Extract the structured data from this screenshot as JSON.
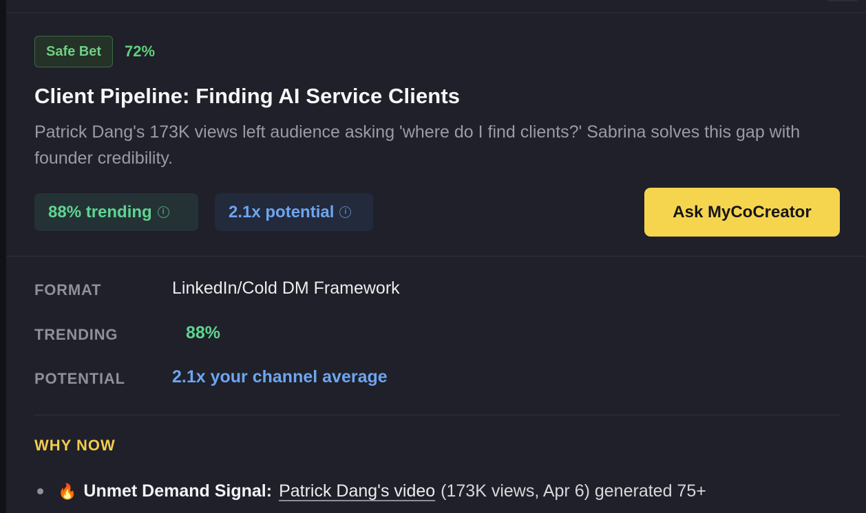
{
  "card": {
    "badge": {
      "label": "Safe Bet",
      "percent": "72%"
    },
    "title": "Client Pipeline: Finding AI Service Clients",
    "description": "Patrick Dang's 173K views left audience asking 'where do I find clients?' Sabrina solves this gap with founder credibility.",
    "chips": {
      "trending": "88% trending",
      "potential": "2.1x potential",
      "info_glyph": "i"
    },
    "ask_button": "Ask MyCoCreator"
  },
  "meta": {
    "format_label": "FORMAT",
    "format_value": "LinkedIn/Cold DM Framework",
    "trending_label": "TRENDING",
    "trending_value": "88%",
    "potential_label": "POTENTIAL",
    "potential_value": "2.1x your channel average"
  },
  "why_now": {
    "title": "WHY NOW",
    "items": [
      {
        "icon": "fire-icon",
        "icon_glyph": "🔥",
        "label": "Unmet Demand Signal:",
        "link_text": "Patrick Dang's video",
        "rest": "(173K views, Apr 6) generated 75+"
      }
    ]
  },
  "colors": {
    "background": "#1f2029",
    "safe_green": "#5fd07a",
    "trending_green": "#5fd490",
    "potential_blue": "#6ea5f0",
    "accent_yellow": "#f6d54e",
    "why_now_yellow": "#f2cc4c"
  }
}
